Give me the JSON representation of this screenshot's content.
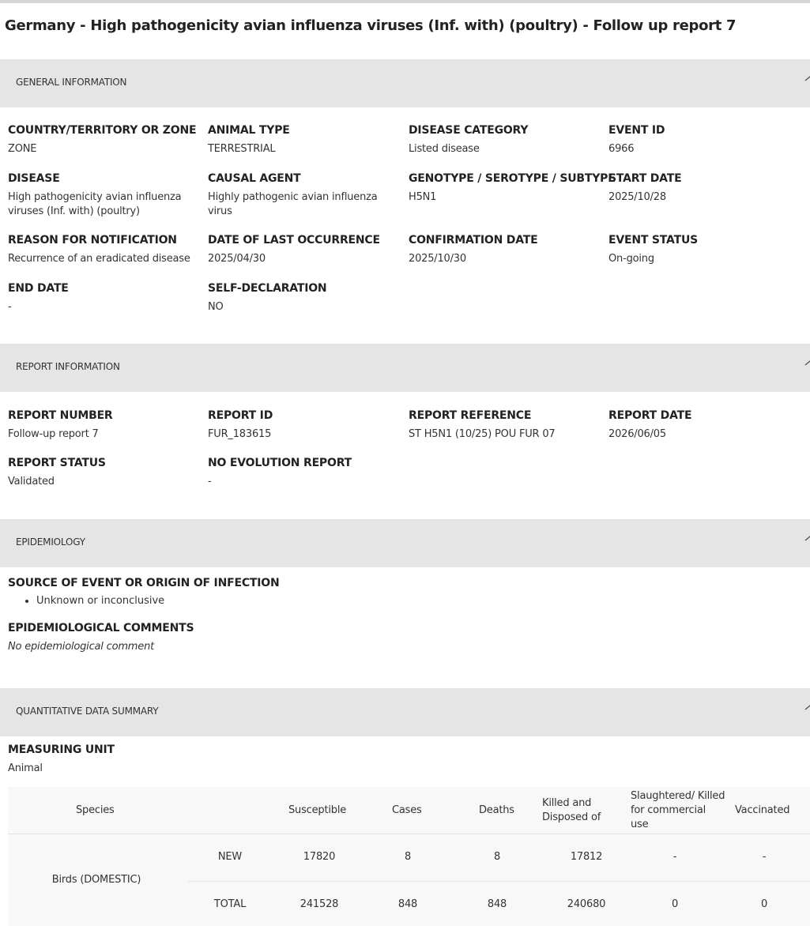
{
  "page_title": "Germany - High pathogenicity avian influenza viruses (Inf. with) (poultry) - Follow up report 7",
  "sections": {
    "general": {
      "title": "GENERAL INFORMATION",
      "fields": [
        {
          "label": "COUNTRY/TERRITORY OR ZONE",
          "value": "ZONE"
        },
        {
          "label": "ANIMAL TYPE",
          "value": "TERRESTRIAL"
        },
        {
          "label": "DISEASE CATEGORY",
          "value": "Listed disease"
        },
        {
          "label": "EVENT ID",
          "value": "6966"
        },
        {
          "label": "DISEASE",
          "value": "High pathogenicity avian influenza viruses (Inf. with) (poultry)"
        },
        {
          "label": "CAUSAL AGENT",
          "value": "Highly pathogenic avian influenza virus"
        },
        {
          "label": "GENOTYPE / SEROTYPE / SUBTYPE",
          "value": "H5N1"
        },
        {
          "label": "START DATE",
          "value": "2025/10/28"
        },
        {
          "label": "REASON FOR NOTIFICATION",
          "value": "Recurrence of an eradicated disease"
        },
        {
          "label": "DATE OF LAST OCCURRENCE",
          "value": "2025/04/30"
        },
        {
          "label": "CONFIRMATION DATE",
          "value": "2025/10/30"
        },
        {
          "label": "EVENT STATUS",
          "value": "On-going"
        },
        {
          "label": "END DATE",
          "value": "-"
        },
        {
          "label": "SELF-DECLARATION",
          "value": "NO"
        }
      ]
    },
    "report": {
      "title": "REPORT INFORMATION",
      "fields": [
        {
          "label": "REPORT NUMBER",
          "value": "Follow-up report 7"
        },
        {
          "label": "REPORT ID",
          "value": "FUR_183615"
        },
        {
          "label": "REPORT REFERENCE",
          "value": "ST H5N1 (10/25) POU FUR 07"
        },
        {
          "label": "REPORT DATE",
          "value": "2026/06/05"
        },
        {
          "label": "REPORT STATUS",
          "value": "Validated"
        },
        {
          "label": "NO EVOLUTION REPORT",
          "value": "-"
        }
      ]
    },
    "epidemiology": {
      "title": "EPIDEMIOLOGY",
      "source_label": "SOURCE OF EVENT OR ORIGIN OF INFECTION",
      "source_items": [
        "Unknown or inconclusive"
      ],
      "comments_label": "EPIDEMIOLOGICAL COMMENTS",
      "comments_value": "No epidemiological comment"
    },
    "quantitative": {
      "title": "QUANTITATIVE DATA SUMMARY",
      "unit_label": "MEASURING UNIT",
      "unit_value": "Animal",
      "columns": [
        "Species",
        "Susceptible",
        "Cases",
        "Deaths",
        "Killed and Disposed of",
        "Slaughtered/ Killed for commercial use",
        "Vaccinated"
      ],
      "species": "Birds (DOMESTIC)",
      "rows": [
        {
          "kind": "NEW",
          "values": [
            "17820",
            "8",
            "8",
            "17812",
            "-",
            "-"
          ]
        },
        {
          "kind": "TOTAL",
          "values": [
            "241528",
            "848",
            "848",
            "240680",
            "0",
            "0"
          ]
        }
      ]
    }
  }
}
